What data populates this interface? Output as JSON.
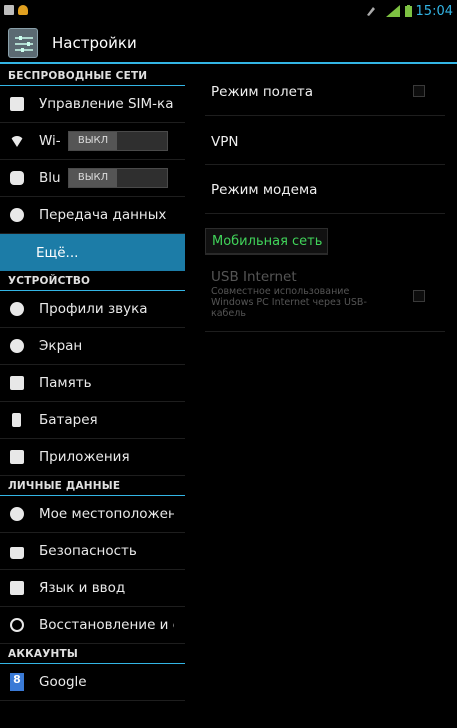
{
  "status_bar": {
    "time": "15:04",
    "icons": [
      "image-icon",
      "warning-icon",
      "mute-icon",
      "signal-icon",
      "battery-icon"
    ],
    "time_color": "#33b5e5"
  },
  "action_bar": {
    "title": "Настройки",
    "accent": "#33b5e5"
  },
  "sidebar": {
    "sections": [
      {
        "header": "БЕСПРОВОДНЫЕ СЕТИ",
        "items": [
          {
            "label": "Управление SIM-кар",
            "icon": "sim-card-icon"
          },
          {
            "label": "Wi-",
            "icon": "wifi-icon",
            "toggle": "ВЫКЛ"
          },
          {
            "label": "Blu",
            "icon": "bluetooth-icon",
            "toggle": "ВЫКЛ"
          },
          {
            "label": "Передача данных",
            "icon": "data-usage-icon"
          },
          {
            "label": "Ещё...",
            "selected": true
          }
        ]
      },
      {
        "header": "УСТРОЙСТВО",
        "items": [
          {
            "label": "Профили звука",
            "icon": "sound-icon"
          },
          {
            "label": "Экран",
            "icon": "display-icon"
          },
          {
            "label": "Память",
            "icon": "storage-icon"
          },
          {
            "label": "Батарея",
            "icon": "battery-icon"
          },
          {
            "label": "Приложения",
            "icon": "apps-icon"
          }
        ]
      },
      {
        "header": "ЛИЧНЫЕ ДАННЫЕ",
        "items": [
          {
            "label": "Мое местоположени",
            "icon": "location-icon"
          },
          {
            "label": "Безопасность",
            "icon": "lock-icon"
          },
          {
            "label": "Язык и ввод",
            "icon": "keyboard-icon"
          },
          {
            "label": "Восстановление и с",
            "icon": "backup-icon"
          }
        ]
      },
      {
        "header": "АККАУНТЫ",
        "items": [
          {
            "label": "Google",
            "icon": "google-icon"
          }
        ]
      }
    ]
  },
  "main": {
    "items": [
      {
        "label": "Режим полета",
        "checkbox": false
      },
      {
        "label": "VPN"
      },
      {
        "label": "Режим модема"
      },
      {
        "label": "Мобильная сеть",
        "highlight_color": "#41d35a"
      },
      {
        "label": "USB Internet",
        "summary": "Совместное использование Windows PC Internet через USB-кабель",
        "checkbox": false,
        "disabled": true
      }
    ]
  }
}
